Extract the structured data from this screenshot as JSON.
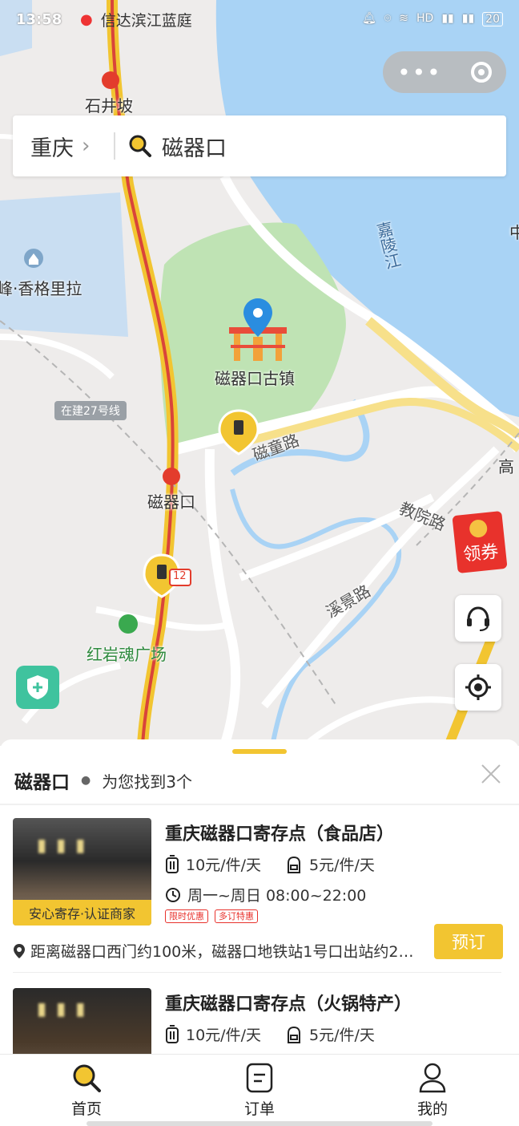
{
  "status_bar": {
    "time": "13:58",
    "app_name": "信达滨江蓝庭",
    "icons": [
      "bell-icon",
      "location-icon",
      "wifi-icon",
      "hd-icon",
      "signal-icon",
      "signal-icon",
      "battery-icon"
    ],
    "battery": "20"
  },
  "capsule": {
    "more_icon": "more-dots-icon",
    "close_icon": "target-ring-icon"
  },
  "search": {
    "city": "重庆",
    "query": "磁器口"
  },
  "map": {
    "labels": {
      "shijingpo": "石井坡",
      "shangrila": "峰·香格里拉",
      "jialingjiang": "嘉陵江",
      "ciqikou_town": "磁器口古镇",
      "line27": "在建27号线",
      "citong_road": "磁童路",
      "ciqikou_station": "磁器口",
      "jiaoyuan_road": "教院路",
      "xijing_road": "溪景路",
      "hongyanhun": "红岩魂广场",
      "gao": "高",
      "zhong": "中",
      "route_number": "12"
    },
    "coupon_label": "领券",
    "colors": {
      "water": "#a9d3f5",
      "park": "#bfe3b4",
      "road": "#ffffff",
      "highway": "#f2c531",
      "accent": "#f2c531"
    }
  },
  "sheet": {
    "query": "磁器口",
    "found_text": "为您找到3个"
  },
  "results": [
    {
      "title": "重庆磁器口寄存点（食品店）",
      "price_luggage": "10元/件/天",
      "price_bag": "5元/件/天",
      "hours": "周一~周日 08:00~22:00",
      "tags": [
        "限时优惠",
        "多订特惠"
      ],
      "cert": "安心寄存·认证商家",
      "address": "距离磁器口西门约100米，磁器口地铁站1号口出站约2…",
      "book_label": "预订"
    },
    {
      "title": "重庆磁器口寄存点（火锅特产）",
      "price_luggage": "10元/件/天",
      "price_bag": "5元/件/天"
    }
  ],
  "tabbar": [
    {
      "label": "首页",
      "icon": "search-icon",
      "active": true
    },
    {
      "label": "订单",
      "icon": "order-icon",
      "active": false
    },
    {
      "label": "我的",
      "icon": "user-icon",
      "active": false
    }
  ]
}
